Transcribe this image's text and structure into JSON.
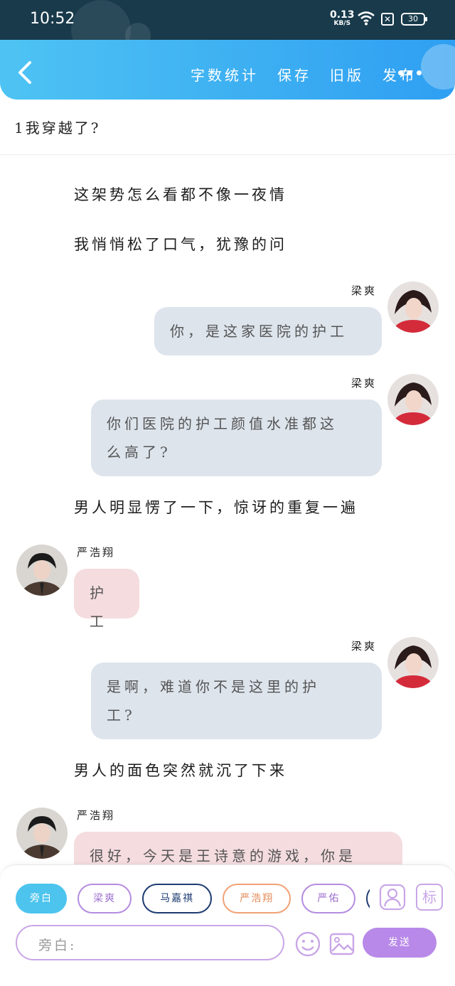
{
  "status_bar": {
    "time": "10:52",
    "net_speed_value": "0.13",
    "net_speed_unit": "KB/S",
    "battery": "30"
  },
  "header": {
    "actions": [
      "字数统计",
      "保存",
      "旧版",
      "发布"
    ],
    "accent_gradient": [
      "#4ec3f3",
      "#2f9ff2"
    ]
  },
  "chapter_title": "1我穿越了?",
  "messages": [
    {
      "type": "narration",
      "text": "这架势怎么看都不像一夜情"
    },
    {
      "type": "narration",
      "text": "我悄悄松了口气，犹豫的问"
    },
    {
      "type": "dialog",
      "side": "right",
      "speaker": "梁爽",
      "lines": [
        "你，是这家医院的护工"
      ]
    },
    {
      "type": "dialog",
      "side": "right",
      "speaker": "梁爽",
      "lines": [
        "你们医院的护工颜值水准都这",
        "么高了?"
      ]
    },
    {
      "type": "narration",
      "text": "男人明显愣了一下，惊讶的重复一遍"
    },
    {
      "type": "dialog",
      "side": "left",
      "speaker": "严浩翔",
      "lines": [
        "护工"
      ]
    },
    {
      "type": "dialog",
      "side": "right",
      "speaker": "梁爽",
      "lines": [
        "是啊，难道你不是这里的护",
        "工?"
      ]
    },
    {
      "type": "narration",
      "text": "男人的面色突然就沉了下来"
    },
    {
      "type": "dialog",
      "side": "left",
      "speaker": "严浩翔",
      "lines": [
        "很好，今天是王诗意的游戏，你是"
      ]
    }
  ],
  "composer": {
    "roles": [
      {
        "label": "旁白",
        "border": "#4cc4ee",
        "fill": "#4cc4ee",
        "text": "#ffffff"
      },
      {
        "label": "梁爽",
        "border": "#b58ce0",
        "fill": "#ffffff",
        "text": "#9c6fd0"
      },
      {
        "label": "马嘉祺",
        "border": "#1e3c72",
        "fill": "#ffffff",
        "text": "#1e3c72"
      },
      {
        "label": "严浩翔",
        "border": "#f0a276",
        "fill": "#ffffff",
        "text": "#e58a57"
      },
      {
        "label": "严佑",
        "border": "#b58ce0",
        "fill": "#ffffff",
        "text": "#9c6fd0"
      }
    ],
    "input_placeholder": "旁白:",
    "send_label": "发送",
    "tag_icon_label": "标",
    "icons": [
      "add-character-icon",
      "tag-icon",
      "emoji-icon",
      "image-icon"
    ]
  }
}
